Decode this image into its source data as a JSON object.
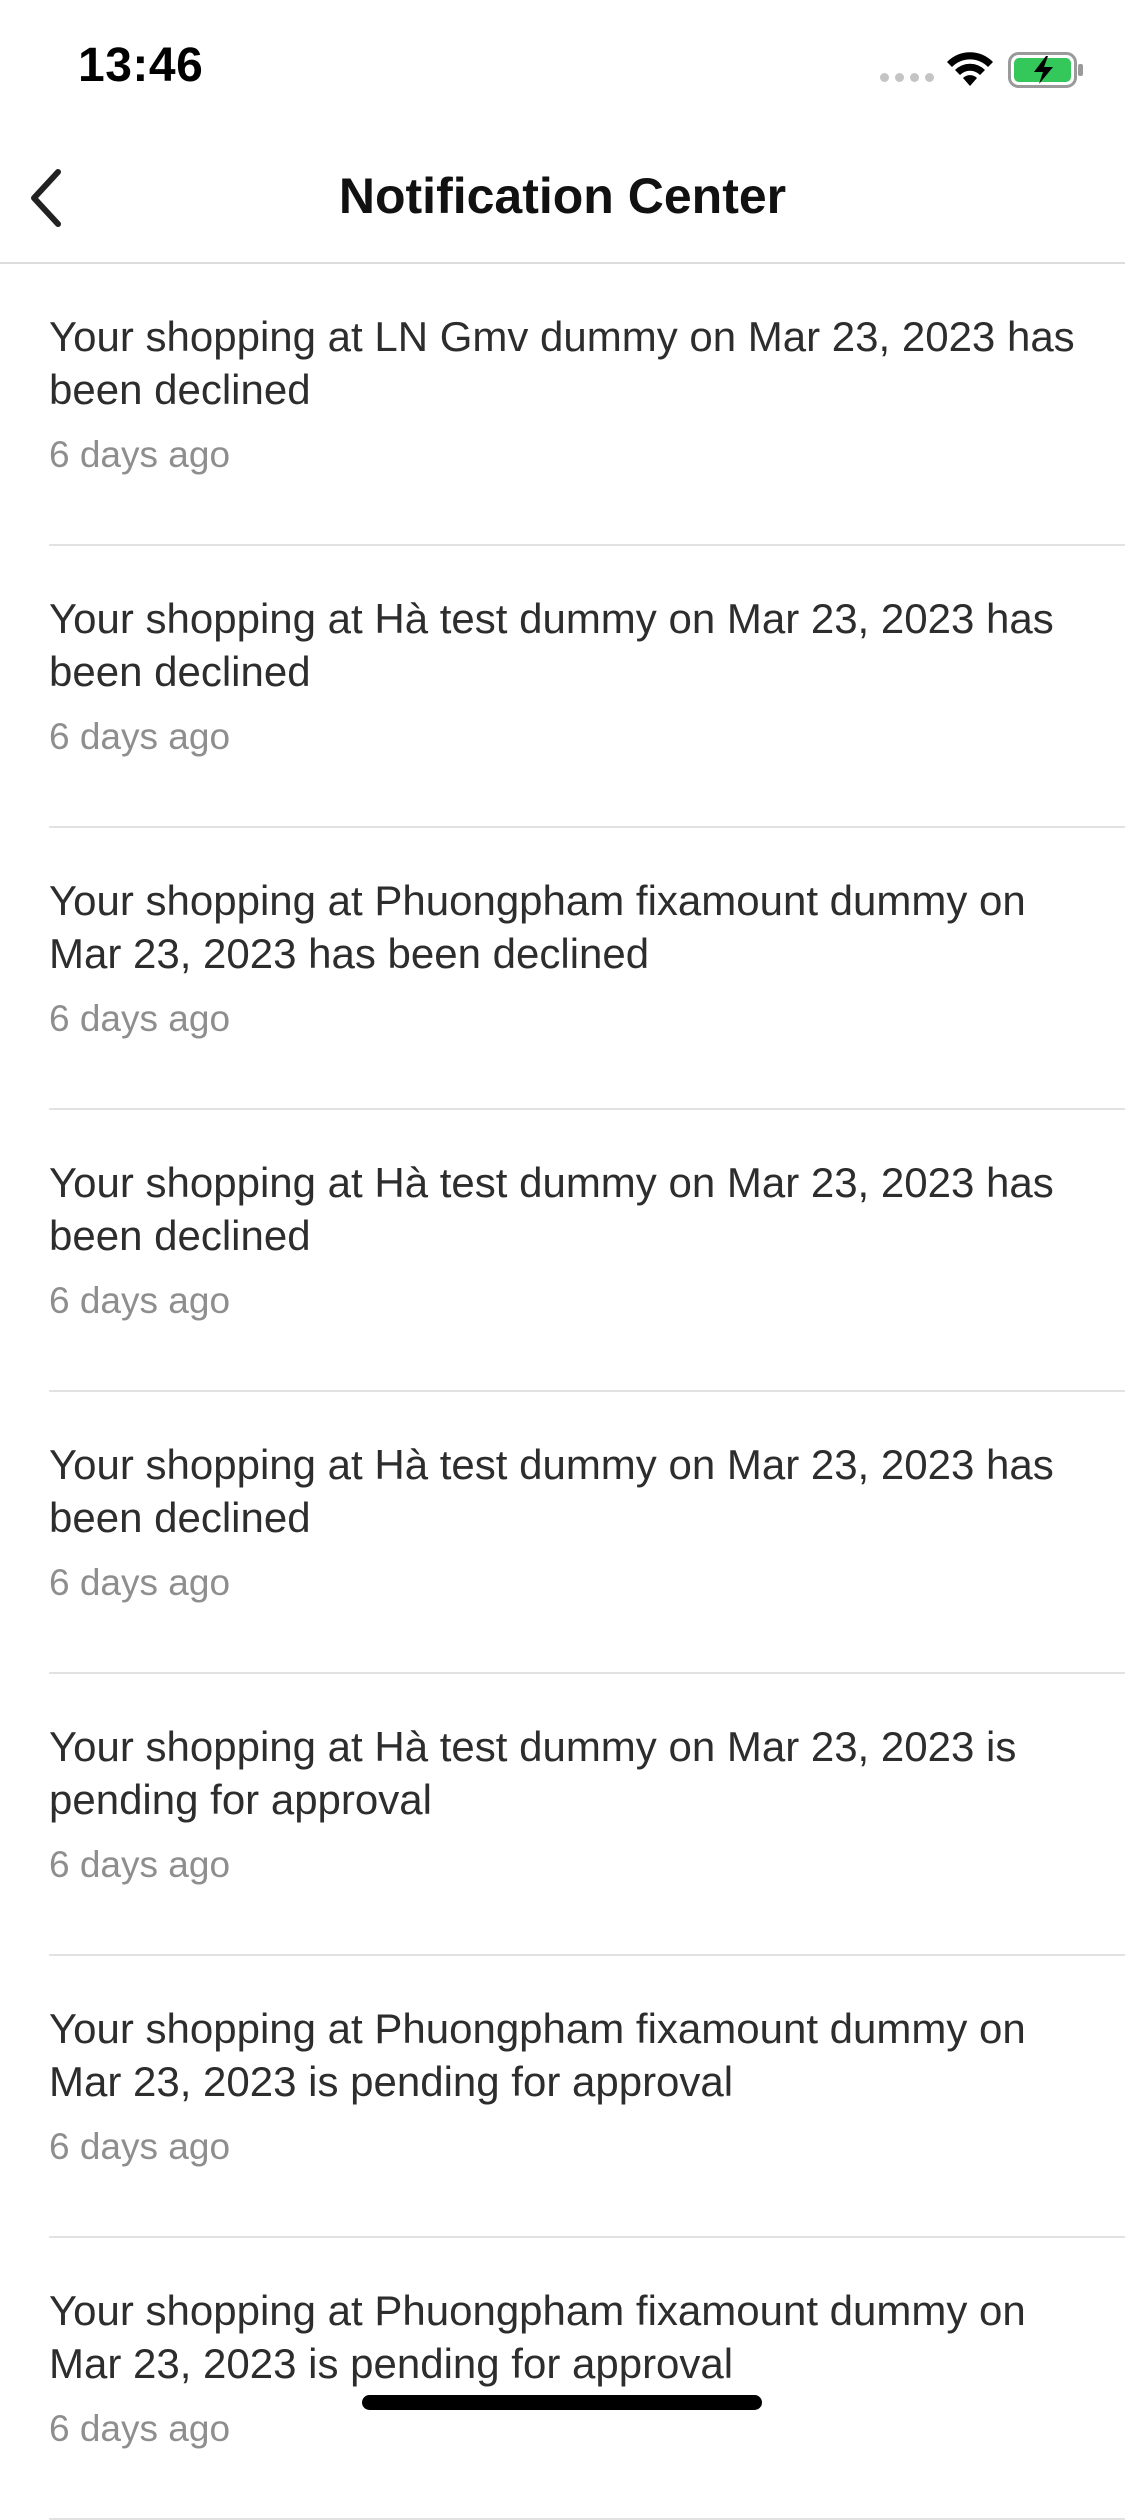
{
  "status_bar": {
    "time": "13:46",
    "icons": [
      "signal-icon",
      "wifi-icon",
      "battery-charging-icon"
    ],
    "battery_color": "#34c759"
  },
  "header": {
    "title": "Notification Center",
    "back_icon": "chevron-left-icon"
  },
  "notifications": [
    {
      "text": "Your shopping at LN Gmv dummy on Mar 23, 2023 has been declined",
      "time": "6 days ago"
    },
    {
      "text": "Your shopping at Hà test dummy on Mar 23, 2023 has been declined",
      "time": "6 days ago"
    },
    {
      "text": "Your shopping at Phuongpham fixamount dummy on Mar 23, 2023 has been declined",
      "time": "6 days ago"
    },
    {
      "text": "Your shopping at Hà test dummy on Mar 23, 2023 has been declined",
      "time": "6 days ago"
    },
    {
      "text": "Your shopping at Hà test dummy on Mar 23, 2023 has been declined",
      "time": "6 days ago"
    },
    {
      "text": "Your shopping at Hà test dummy on Mar 23, 2023 is pending for approval",
      "time": "6 days ago"
    },
    {
      "text": "Your shopping at Phuongpham fixamount dummy on Mar 23, 2023 is pending for approval",
      "time": "6 days ago"
    },
    {
      "text": "Your shopping at Phuongpham fixamount dummy on Mar 23, 2023 is pending for approval",
      "time": "6 days ago"
    }
  ]
}
